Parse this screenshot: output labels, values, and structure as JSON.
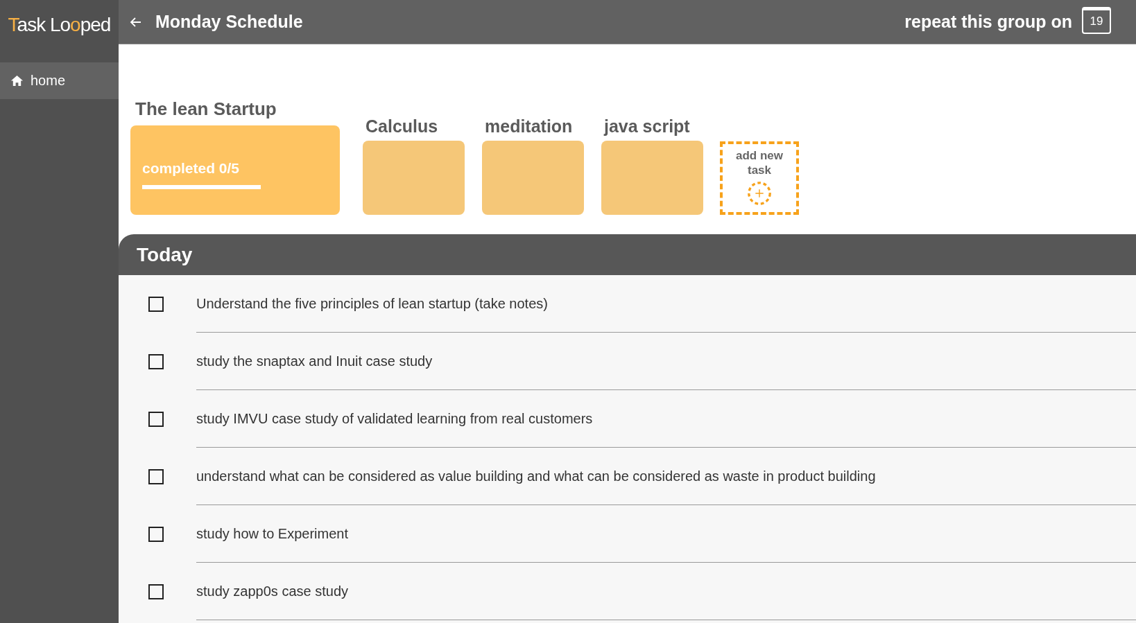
{
  "logo": {
    "parts": [
      {
        "text": "T",
        "accent": true
      },
      {
        "text": "ask Lo",
        "accent": false
      },
      {
        "text": "o",
        "accent": true
      },
      {
        "text": "ped",
        "accent": false
      }
    ]
  },
  "sidebar": {
    "items": [
      {
        "label": "home",
        "selected": true
      }
    ]
  },
  "header": {
    "title": "Monday Schedule",
    "repeat_label": "repeat this group on",
    "calendar_day": "19"
  },
  "groups": [
    {
      "title": "The lean Startup",
      "selected": true,
      "progress_text": "completed 0/5"
    },
    {
      "title": "Calculus",
      "selected": false
    },
    {
      "title": "meditation",
      "selected": false
    },
    {
      "title": "java script",
      "selected": false
    }
  ],
  "add_task": {
    "label": "add new task"
  },
  "today": {
    "title": "Today",
    "tasks": [
      {
        "text": "Understand the five principles of lean startup (take notes)",
        "checked": false
      },
      {
        "text": "study the snaptax and Inuit case study",
        "checked": false
      },
      {
        "text": "study IMVU case study of validated learning from real customers",
        "checked": false
      },
      {
        "text": "understand what can be considered as value building and what can be considered as waste in product building",
        "checked": false
      },
      {
        "text": "study how to Experiment",
        "checked": false
      },
      {
        "text": "study zapp0s case study",
        "checked": false
      }
    ]
  }
}
